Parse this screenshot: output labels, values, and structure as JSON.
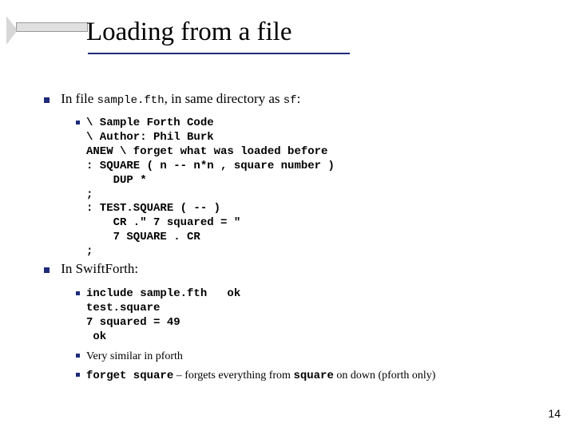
{
  "title": "Loading from a file",
  "lvl1": {
    "a": {
      "prefix": "In file ",
      "code1": "sample.fth",
      "middle": ", in same directory as ",
      "code2": "sf",
      "suffix": ":"
    },
    "b": "In SwiftForth:"
  },
  "codeA": "\\ Sample Forth Code\n\\ Author: Phil Burk\nANEW \\ forget what was loaded before\n: SQUARE ( n -- n*n , square number )\n    DUP *\n;\n: TEST.SQUARE ( -- )\n    CR .\" 7 squared = \"\n    7 SQUARE . CR\n;",
  "codeB": {
    "block": "include sample.fth   ok\ntest.square\n7 squared = 49\n ok",
    "note1": "Very similar in pforth",
    "note2_code": "forget square",
    "note2_mid": " – forgets everything from ",
    "note2_code2": "square",
    "note2_tail": " on down (pforth only)"
  },
  "page": "14"
}
